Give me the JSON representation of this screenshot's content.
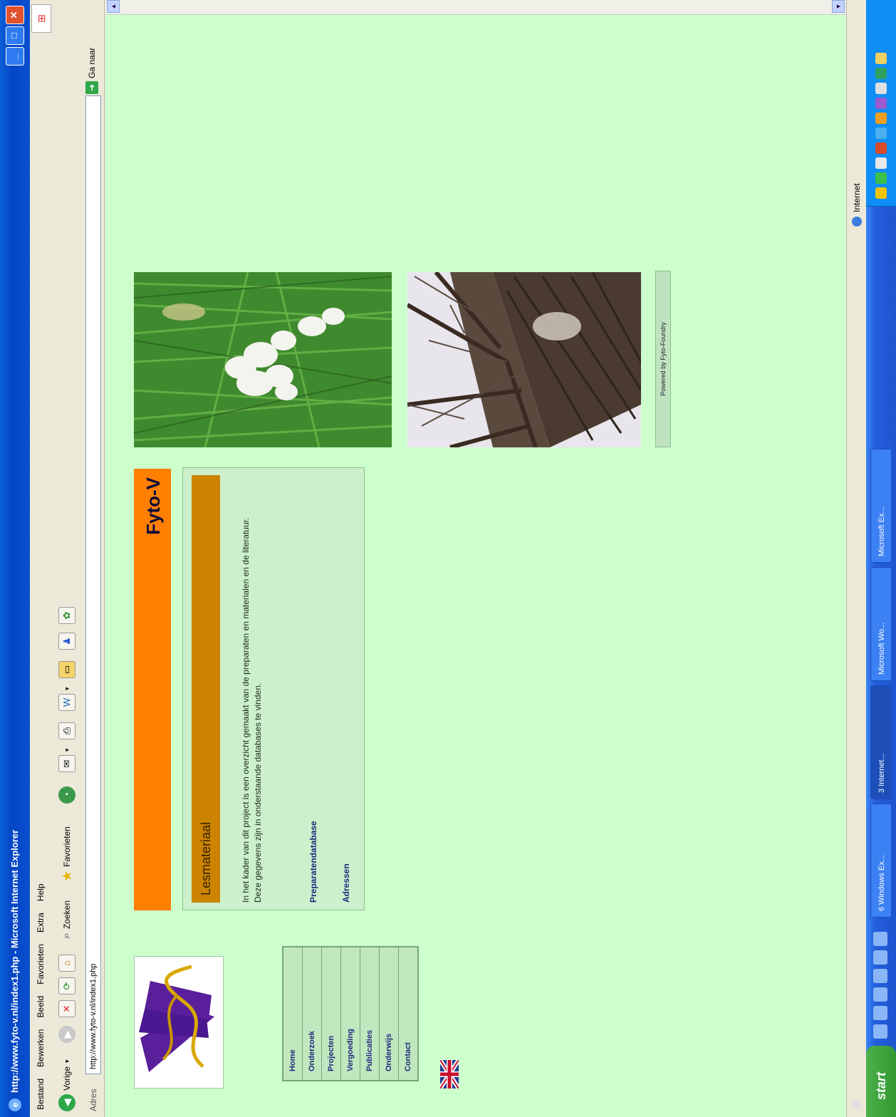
{
  "window": {
    "title": "http://www.fyto-v.nl/index1.php - Microsoft Internet Explorer",
    "min_label": "_",
    "max_label": "□",
    "close_label": "✕"
  },
  "menu": {
    "items": [
      "Bestand",
      "Bewerken",
      "Beeld",
      "Favorieten",
      "Extra",
      "Help"
    ]
  },
  "toolbar": {
    "back_label": "Vorige",
    "search_label": "Zoeken",
    "favorites_label": "Favorieten"
  },
  "address": {
    "label": "Adres",
    "value": "http://www.fyto-v.nl/index1.php",
    "go_label": "Ga naar"
  },
  "page": {
    "site_title": "Fyto-V",
    "nav": [
      "Home",
      "Onderzoek",
      "Projecten",
      "Vergoeding",
      "Publicaties",
      "Onderwijs",
      "Contact"
    ],
    "content": {
      "heading": "Lesmateriaal",
      "intro": "In het kader van dit project is een overzicht gemaakt van de preparaten en materialen en de literatuur. Deze gegevens zijn in onderstaande databases te vinden.",
      "link1": "Preparatendatabase",
      "link2": "Adressen"
    },
    "credit": "Powered by Fyto-Foundry"
  },
  "status": {
    "left": "",
    "zone": "Internet"
  },
  "taskbar": {
    "start_label": "start",
    "tasks": [
      "6 Windows Ex...",
      "3 Internet...",
      "Microsoft Wo...",
      "Microsoft Ex..."
    ],
    "clock": ""
  }
}
